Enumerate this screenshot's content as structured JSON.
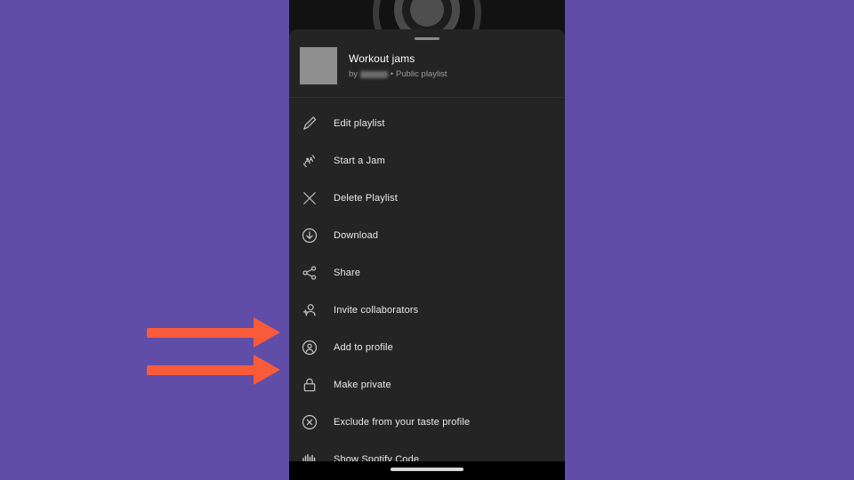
{
  "annotation": {
    "arrow_color": "#F95B3A",
    "background_color": "#5F4DA8",
    "arrows": [
      {
        "name": "arrow-add-to-profile",
        "points_to": "Add to profile"
      },
      {
        "name": "arrow-make-private",
        "points_to": "Make private"
      }
    ]
  },
  "phone": {
    "sheet_background": "#242424",
    "backdrop_background": "#121212",
    "header": {
      "title": "Workout jams",
      "by_word": "by",
      "owner": "Sandra",
      "separator": "•",
      "visibility": "Public playlist",
      "cover_color": "#8F8F8F"
    },
    "menu": {
      "items": [
        {
          "icon": "pencil-icon",
          "label": "Edit playlist"
        },
        {
          "icon": "jam-icon",
          "label": "Start a Jam"
        },
        {
          "icon": "close-x-icon",
          "label": "Delete Playlist"
        },
        {
          "icon": "download-icon",
          "label": "Download"
        },
        {
          "icon": "share-icon",
          "label": "Share"
        },
        {
          "icon": "add-person-icon",
          "label": "Invite collaborators"
        },
        {
          "icon": "profile-circle-icon",
          "label": "Add to profile"
        },
        {
          "icon": "lock-icon",
          "label": "Make private"
        },
        {
          "icon": "exclude-circle-icon",
          "label": "Exclude from your taste profile"
        },
        {
          "icon": "spotify-code-icon",
          "label": "Show Spotify Code"
        }
      ]
    },
    "navbar": {
      "home_indicator_color": "#D8D8D8"
    }
  }
}
